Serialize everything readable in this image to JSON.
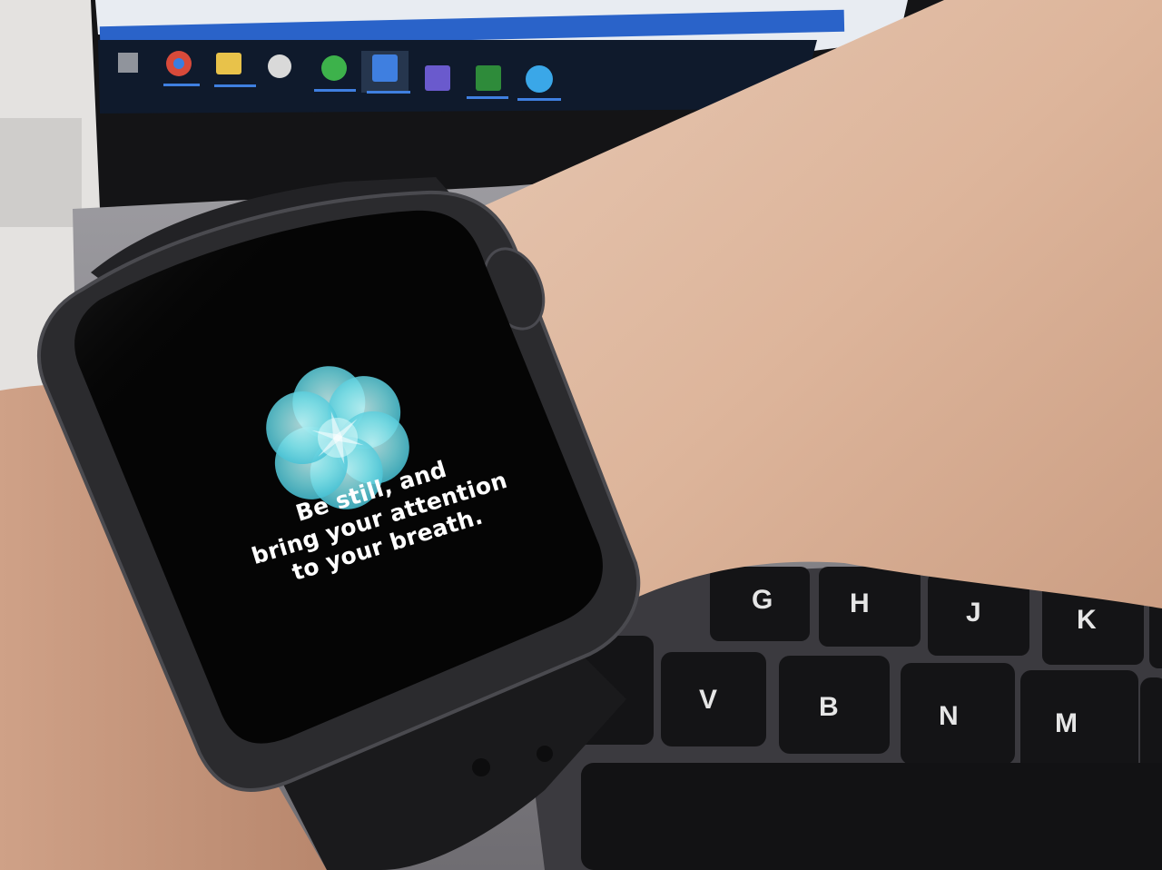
{
  "watch_screen": {
    "app": "Breathe",
    "icon": "lotus-flower-icon",
    "message_lines": [
      "Be still, and",
      "bring your attention",
      "to your breath."
    ]
  },
  "keyboard": {
    "keys": [
      "G",
      "H",
      "J",
      "K",
      "V",
      "B",
      "N",
      "M"
    ]
  },
  "taskbar": {
    "icons": [
      "windows-start-icon",
      "chrome-icon",
      "file-explorer-icon",
      "app-icon",
      "whatsapp-icon",
      "visual-studio-code-icon",
      "visual-studio-icon",
      "excel-icon",
      "app-icon-blue"
    ]
  },
  "colors": {
    "breathe_teal": "#5fd3e0",
    "breathe_light": "#a6eff2",
    "watch_case": "#2b2b2e",
    "skin": "#dcb8a0"
  }
}
